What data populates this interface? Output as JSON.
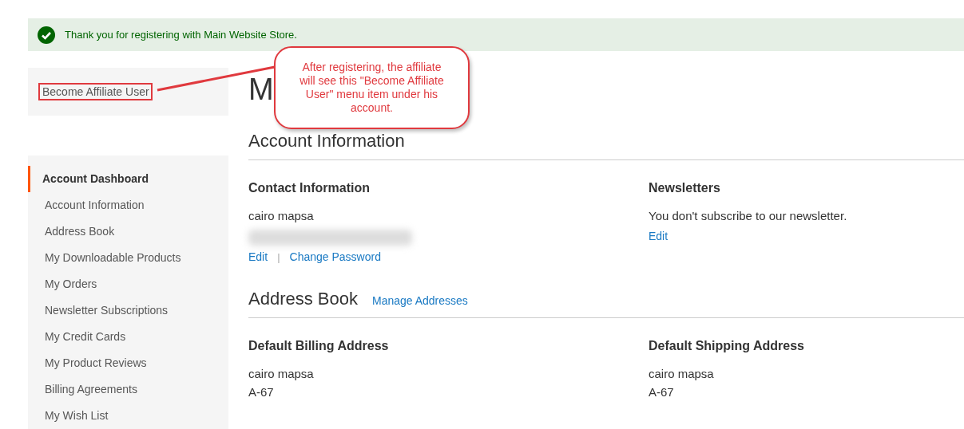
{
  "message": {
    "text": "Thank you for registering with Main Website Store."
  },
  "affiliate_link": "Become Affiliate User",
  "sidebar": {
    "items": [
      {
        "label": "Account Dashboard",
        "selected": true
      },
      {
        "label": "Account Information",
        "selected": false
      },
      {
        "label": "Address Book",
        "selected": false
      },
      {
        "label": "My Downloadable Products",
        "selected": false
      },
      {
        "label": "My Orders",
        "selected": false
      },
      {
        "label": "Newsletter Subscriptions",
        "selected": false
      },
      {
        "label": "My Credit Cards",
        "selected": false
      },
      {
        "label": "My Product Reviews",
        "selected": false
      },
      {
        "label": "Billing Agreements",
        "selected": false
      },
      {
        "label": "My Wish List",
        "selected": false
      }
    ]
  },
  "page_title": "M",
  "sections": [
    {
      "title": "Account Information",
      "boxes": [
        {
          "title": "Contact Information",
          "lines": [
            "cairo mapsa"
          ],
          "redacted": true,
          "actions": [
            "Edit",
            "Change Password"
          ],
          "separator": "|"
        },
        {
          "title": "Newsletters",
          "lines": [
            "You don't subscribe to our newsletter."
          ],
          "actions": [
            "Edit"
          ]
        }
      ]
    },
    {
      "title": "Address Book",
      "link": "Manage Addresses",
      "boxes": [
        {
          "title": "Default Billing Address",
          "lines": [
            "cairo mapsa",
            "A-67"
          ]
        },
        {
          "title": "Default Shipping Address",
          "lines": [
            "cairo mapsa",
            "A-67"
          ]
        }
      ]
    }
  ],
  "callout": {
    "text": "After registering, the affiliate will see this \"Become Affiliate User\" menu item under his account."
  }
}
